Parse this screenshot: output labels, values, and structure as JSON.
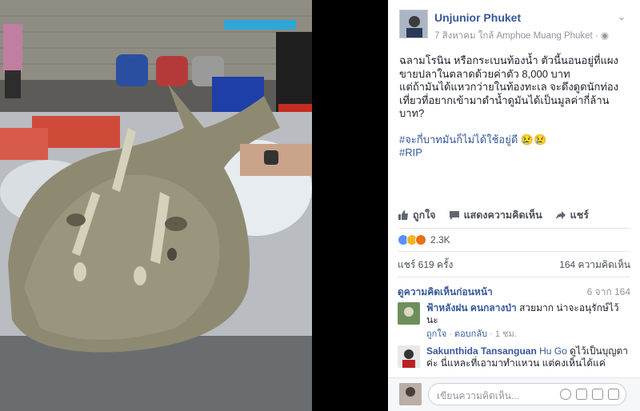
{
  "post": {
    "author": "Unjunior Phuket",
    "meta": "7 สิงหาคม ใกล้ Amphoe Muang Phuket · ",
    "text_lines": [
      "ฉลามโรนิน หรือกระเบนท้องน้ำ ตัวนี้นอนอยู่ที่แผง",
      "ขายปลาในตลาดด้วยค่าตัว 8,000 บาท",
      "แต่ถ้ามันได้แหวกว่ายในท้องทะเล จะดึงดูดนักท่อง",
      "เที่ยวที่อยากเข้ามาดำน้ำดูมันได้เป็นมูลค่ากี่ล้าน",
      "บาท?"
    ],
    "hashtag1": "#จะกี่บาทมันก็ไม่ได้ใช้อยู่ดี 😢😢",
    "hashtag2": "#RIP"
  },
  "actions": {
    "like": "ถูกใจ",
    "comment": "แสดงความคิดเห็น",
    "share": "แชร์"
  },
  "reactions": {
    "count": "2.3K",
    "colors": [
      "#5890ff",
      "#f7b125",
      "#e9710f"
    ]
  },
  "stats": {
    "shares": "แชร์ 619 ครั้ง",
    "comments": "164 ความคิดเห็น"
  },
  "previous": {
    "label": "ดูความคิดเห็นก่อนหน้า",
    "count": "6 จาก 164"
  },
  "comments": [
    {
      "name": "ฟ้าหลังฝน คนกลางป่า",
      "tag": "",
      "text": " สวยมาก น่าจะอนุรักษ์ไว้นะ",
      "like": "ถูกใจ",
      "reply": "ตอบกลับ",
      "time": "1 ชม."
    },
    {
      "name": "Sakunthida Tansanguan",
      "tag": "Hu Go",
      "text": " ดูไว้เป็นบุญตาค่ะ นี่แหละที่เอามาทำแหวน แต่คงเห็นได้แค่",
      "like": "",
      "reply": "",
      "time": ""
    }
  ],
  "composer": {
    "placeholder": "เขียนความคิดเห็น..."
  }
}
